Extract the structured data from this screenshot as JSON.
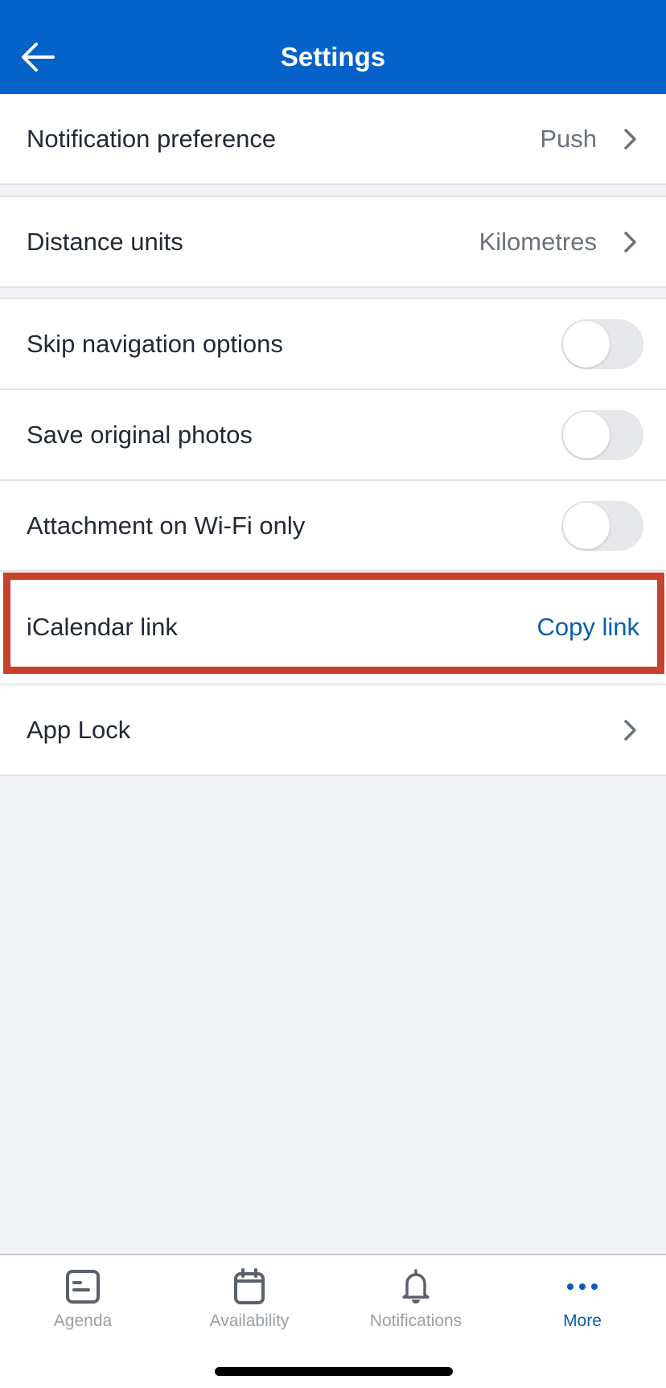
{
  "header": {
    "title": "Settings",
    "back_icon": "arrow-left-icon"
  },
  "settings": {
    "notification_preference": {
      "label": "Notification preference",
      "value": "Push"
    },
    "distance_units": {
      "label": "Distance units",
      "value": "Kilometres"
    },
    "skip_navigation": {
      "label": "Skip navigation options",
      "enabled": false
    },
    "save_photos": {
      "label": "Save original photos",
      "enabled": false
    },
    "wifi_only": {
      "label": "Attachment on Wi-Fi only",
      "enabled": false
    },
    "icalendar": {
      "label": "iCalendar link",
      "action": "Copy link"
    },
    "app_lock": {
      "label": "App Lock"
    }
  },
  "tabbar": {
    "tabs": [
      {
        "label": "Agenda",
        "icon": "agenda-icon",
        "active": false
      },
      {
        "label": "Availability",
        "icon": "calendar-icon",
        "active": false
      },
      {
        "label": "Notifications",
        "icon": "bell-icon",
        "active": false
      },
      {
        "label": "More",
        "icon": "more-dots-icon",
        "active": true
      }
    ]
  },
  "colors": {
    "brand": "#0562C8",
    "link": "#0B5EAA",
    "highlight": "#C8412D"
  }
}
